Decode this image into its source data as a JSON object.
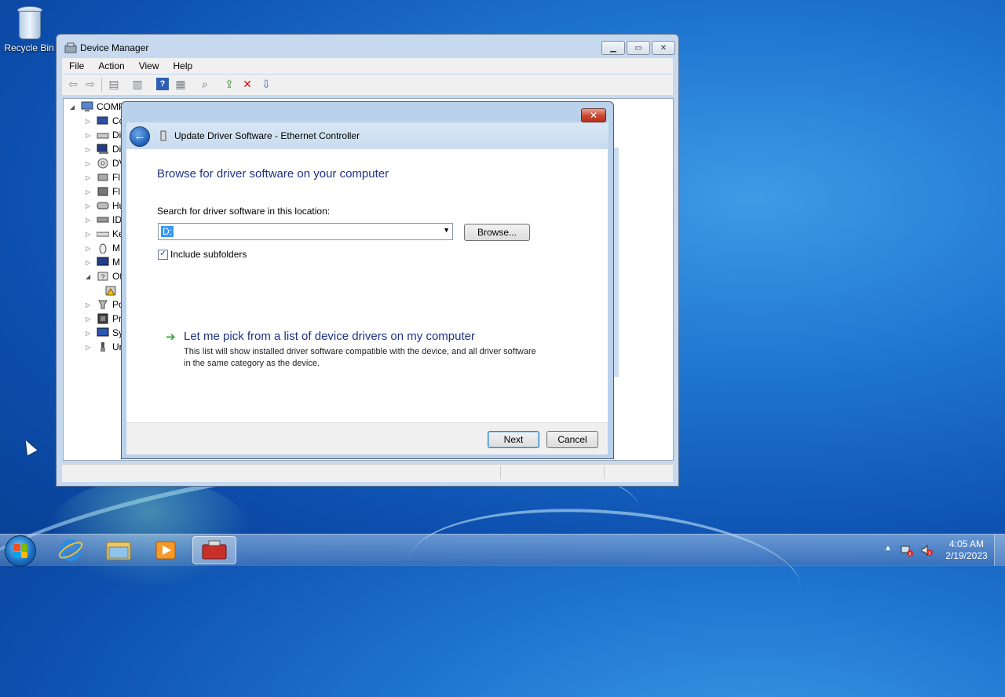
{
  "desktop": {
    "recycle_bin_label": "Recycle Bin"
  },
  "device_manager": {
    "title": "Device Manager",
    "caption_buttons": [
      "minimize",
      "maximize",
      "close"
    ],
    "menu": [
      "File",
      "Action",
      "View",
      "Help"
    ],
    "tree_root": "COMP",
    "tree_items": [
      {
        "label": "Co",
        "icon": "computer-icon",
        "expanded": false
      },
      {
        "label": "Di",
        "icon": "disk-drive-icon",
        "expanded": false
      },
      {
        "label": "Di",
        "icon": "display-adapter-icon",
        "expanded": false
      },
      {
        "label": "DV",
        "icon": "dvd-drive-icon",
        "expanded": false
      },
      {
        "label": "Fl",
        "icon": "floppy-controller-icon",
        "expanded": false
      },
      {
        "label": "Fl",
        "icon": "floppy-drive-icon",
        "expanded": false
      },
      {
        "label": "Hu",
        "icon": "hid-icon",
        "expanded": false
      },
      {
        "label": "ID",
        "icon": "ide-controller-icon",
        "expanded": false
      },
      {
        "label": "Ke",
        "icon": "keyboard-icon",
        "expanded": false
      },
      {
        "label": "M",
        "icon": "mouse-icon",
        "expanded": false
      },
      {
        "label": "M",
        "icon": "monitor-icon",
        "expanded": false
      },
      {
        "label": "Ot",
        "icon": "other-devices-icon",
        "expanded": true
      },
      {
        "label": "",
        "icon": "unknown-device-warning-icon",
        "expanded": false
      },
      {
        "label": "Po",
        "icon": "ports-icon",
        "expanded": false
      },
      {
        "label": "Pr",
        "icon": "processor-icon",
        "expanded": false
      },
      {
        "label": "Sy",
        "icon": "system-devices-icon",
        "expanded": false
      },
      {
        "label": "Ur",
        "icon": "usb-icon",
        "expanded": false
      }
    ]
  },
  "dialog": {
    "window_title": "Update Driver Software - Ethernet Controller",
    "heading": "Browse for driver software on your computer",
    "search_label": "Search for driver software in this location:",
    "search_value": "D:",
    "browse_label": "Browse...",
    "include_subfolders_label": "Include subfolders",
    "include_subfolders_checked": true,
    "pick_link": "Let me pick from a list of device drivers on my computer",
    "pick_desc": "This list will show installed driver software compatible with the device, and all driver software in the same category as the device.",
    "next_label": "Next",
    "cancel_label": "Cancel"
  },
  "taskbar": {
    "apps": [
      "start",
      "internet-explorer",
      "windows-explorer",
      "media-player",
      "device-manager"
    ],
    "active_app": "device-manager",
    "time": "4:05 AM",
    "date": "2/19/2023"
  }
}
